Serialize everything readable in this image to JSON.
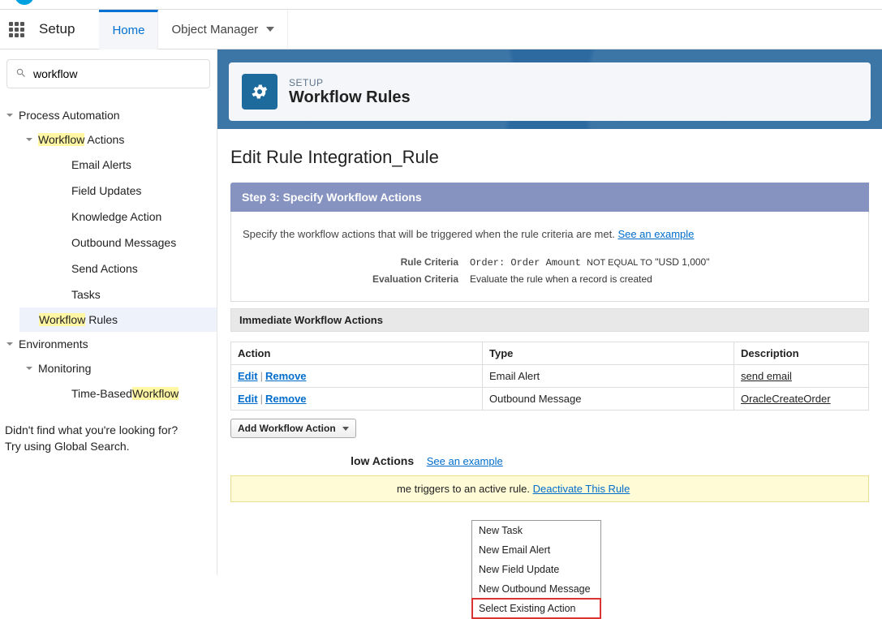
{
  "header": {
    "setup": "Setup",
    "home": "Home",
    "object_manager": "Object Manager"
  },
  "search": {
    "value": "workflow"
  },
  "tree": {
    "process_automation": "Process Automation",
    "workflow_actions_hl": "Workflow",
    "workflow_actions_rest": " Actions",
    "items": [
      "Email Alerts",
      "Field Updates",
      "Knowledge Action",
      "Outbound Messages",
      "Send Actions",
      "Tasks"
    ],
    "workflow_rules_hl": "Workflow",
    "workflow_rules_rest": " Rules",
    "environments": "Environments",
    "monitoring": "Monitoring",
    "time_based_pre": "Time-Based ",
    "time_based_hl": "Workflow"
  },
  "footer_hint_1": "Didn't find what you're looking for?",
  "footer_hint_2": "Try using Global Search.",
  "page": {
    "cap": "SETUP",
    "title": "Workflow Rules",
    "edit_title": "Edit Rule Integration_Rule",
    "step_label": "Step 3: Specify Workflow Actions",
    "desc": "Specify the workflow actions that will be triggered when the rule criteria are met. ",
    "see_example": "See an example",
    "rule_crit_label": "Rule Criteria",
    "rule_crit_mono": "Order: Order Amount ",
    "rule_crit_neq": "NOT EQUAL TO",
    "rule_crit_val": "  \"USD 1,000\"",
    "eval_label": "Evaluation Criteria",
    "eval_val": "Evaluate the rule when a record is created",
    "immediate": "Immediate Workflow Actions",
    "cols": {
      "action": "Action",
      "type": "Type",
      "desc": "Description"
    },
    "edit": "Edit",
    "remove": "Remove",
    "rows": [
      {
        "type": "Email Alert",
        "desc": "send email"
      },
      {
        "type": "Outbound Message",
        "desc": "OracleCreateOrder"
      }
    ],
    "add_btn": "Add Workflow Action",
    "menu": [
      "New Task",
      "New Email Alert",
      "New Field Update",
      "New Outbound Message",
      "Select Existing Action"
    ],
    "time_title_rest": "low Actions",
    "warn_rest": "me triggers to an active rule.  ",
    "deactivate": "Deactivate This Rule"
  }
}
